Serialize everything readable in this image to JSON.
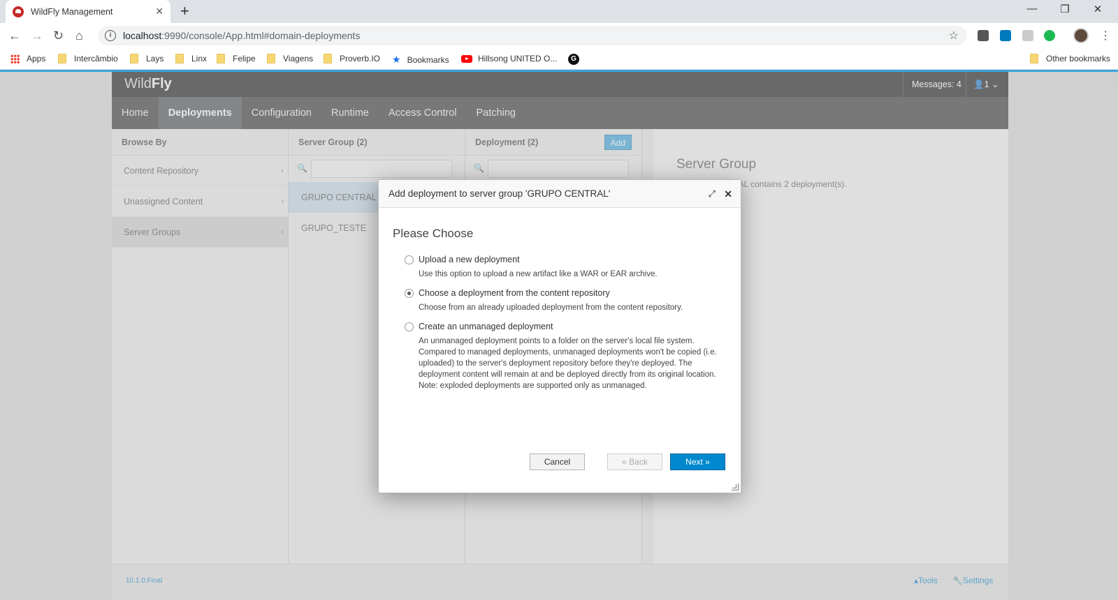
{
  "browser": {
    "tab_title": "WildFly Management",
    "new_tab": "+",
    "url_host": "localhost",
    "url_rest": ":9990/console/App.html#domain-deployments",
    "bookmarks": [
      "Apps",
      "Intercâmbio",
      "Lays",
      "Linx",
      "Felipe",
      "Viagens",
      "Proverb.IO",
      "Bookmarks",
      "Hillsong UNITED O..."
    ],
    "other_bookmarks": "Other bookmarks"
  },
  "masthead": {
    "brand_light": "Wild",
    "brand_bold": "Fly",
    "messages": "Messages: 4",
    "user": "1"
  },
  "nav": [
    "Home",
    "Deployments",
    "Configuration",
    "Runtime",
    "Access Control",
    "Patching"
  ],
  "browse": {
    "header": "Browse By",
    "items": [
      "Content Repository",
      "Unassigned Content",
      "Server Groups"
    ]
  },
  "server_group": {
    "header": "Server Group (2)",
    "items": [
      "GRUPO CENTRAL",
      "GRUPO_TESTE"
    ]
  },
  "deployment": {
    "header": "Deployment (2)",
    "add": "Add"
  },
  "detail": {
    "title": "Server Group",
    "text": "GRUPO CENTRAL contains 2 deployment(s)."
  },
  "footer": {
    "version": "10.1.0.Final",
    "tools": "Tools",
    "settings": "Settings"
  },
  "modal": {
    "title": "Add deployment to server group 'GRUPO CENTRAL'",
    "heading": "Please Choose",
    "options": [
      {
        "label": "Upload a new deployment",
        "desc": "Use this option to upload a new artifact like a WAR or EAR archive."
      },
      {
        "label": "Choose a deployment from the content repository",
        "desc": "Choose from an already uploaded deployment from the content repository."
      },
      {
        "label": "Create an unmanaged deployment",
        "desc": "An unmanaged deployment points to a folder on the server's local file system. Compared to managed deployments, unmanaged deployments won't be copied (i.e. uploaded) to the server's deployment repository before they're deployed. The deployment content will remain at and be deployed directly from its original location. Note: exploded deployments are supported only as unmanaged."
      }
    ],
    "selected_option": 1,
    "cancel": "Cancel",
    "back": "« Back",
    "next": "Next »"
  }
}
